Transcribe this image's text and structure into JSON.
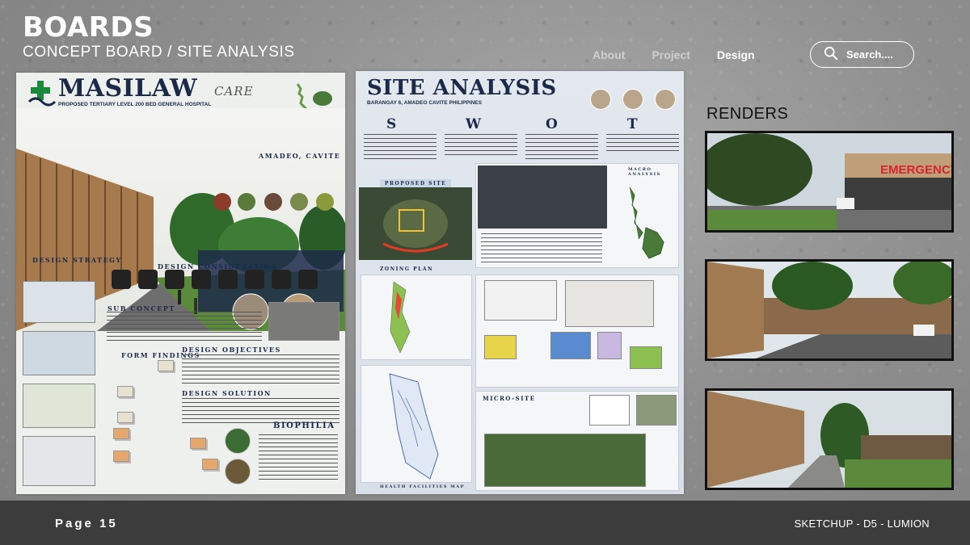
{
  "header": {
    "title": "BOARDS",
    "subtitle": "CONCEPT BOARD / SITE ANALYSIS"
  },
  "nav": {
    "items": [
      {
        "label": "About",
        "active": false
      },
      {
        "label": "Project",
        "active": false
      },
      {
        "label": "Design",
        "active": true
      }
    ]
  },
  "search": {
    "placeholder": "Search....",
    "icon": "search-icon"
  },
  "board_left": {
    "title": "MASILAW",
    "title_suffix": "CARE",
    "subtitle": "PROPOSED TERTIARY LEVEL 200 BED GENERAL HOSPITAL",
    "location": "AMADEO, CAVITE",
    "sections": {
      "design_strategy": "DESIGN STRATEGY",
      "design_consideration": "DESIGN CONSIDERATION",
      "sub_concept": "SUB CONCEPT",
      "form_findings": "FORM FINDINGS",
      "design_objectives": "DESIGN OBJECTIVES",
      "design_solution": "DESIGN SOLUTION",
      "biophilia": "BIOPHILIA"
    }
  },
  "board_right": {
    "title": "SITE ANALYSIS",
    "subtitle": "BARANGAY 6, AMADEO CAVITE PHILIPPINES",
    "swot": [
      "S",
      "W",
      "O",
      "T"
    ],
    "labels": {
      "proposed_site": "PROPOSED SITE",
      "zoning_plan": "ZONING PLAN",
      "macro_analysis": "MACRO ANALYSIS",
      "micro_site": "MICRO-SITE",
      "health_facilities_map": "HEALTH FACILITIES MAP"
    }
  },
  "renders": {
    "heading": "RENDERS",
    "items": [
      {
        "name": "render-emergency-entrance",
        "sign": "EMERGENCY"
      },
      {
        "name": "render-street-view"
      },
      {
        "name": "render-garden-walkway"
      }
    ]
  },
  "footer": {
    "page_label": "Page 15",
    "tools": "SKETCHUP - D5 - LUMION"
  },
  "colors": {
    "footer_bg": "#3c3c3c",
    "board_navy": "#1c2a4a",
    "accent_red": "#d8232a"
  }
}
